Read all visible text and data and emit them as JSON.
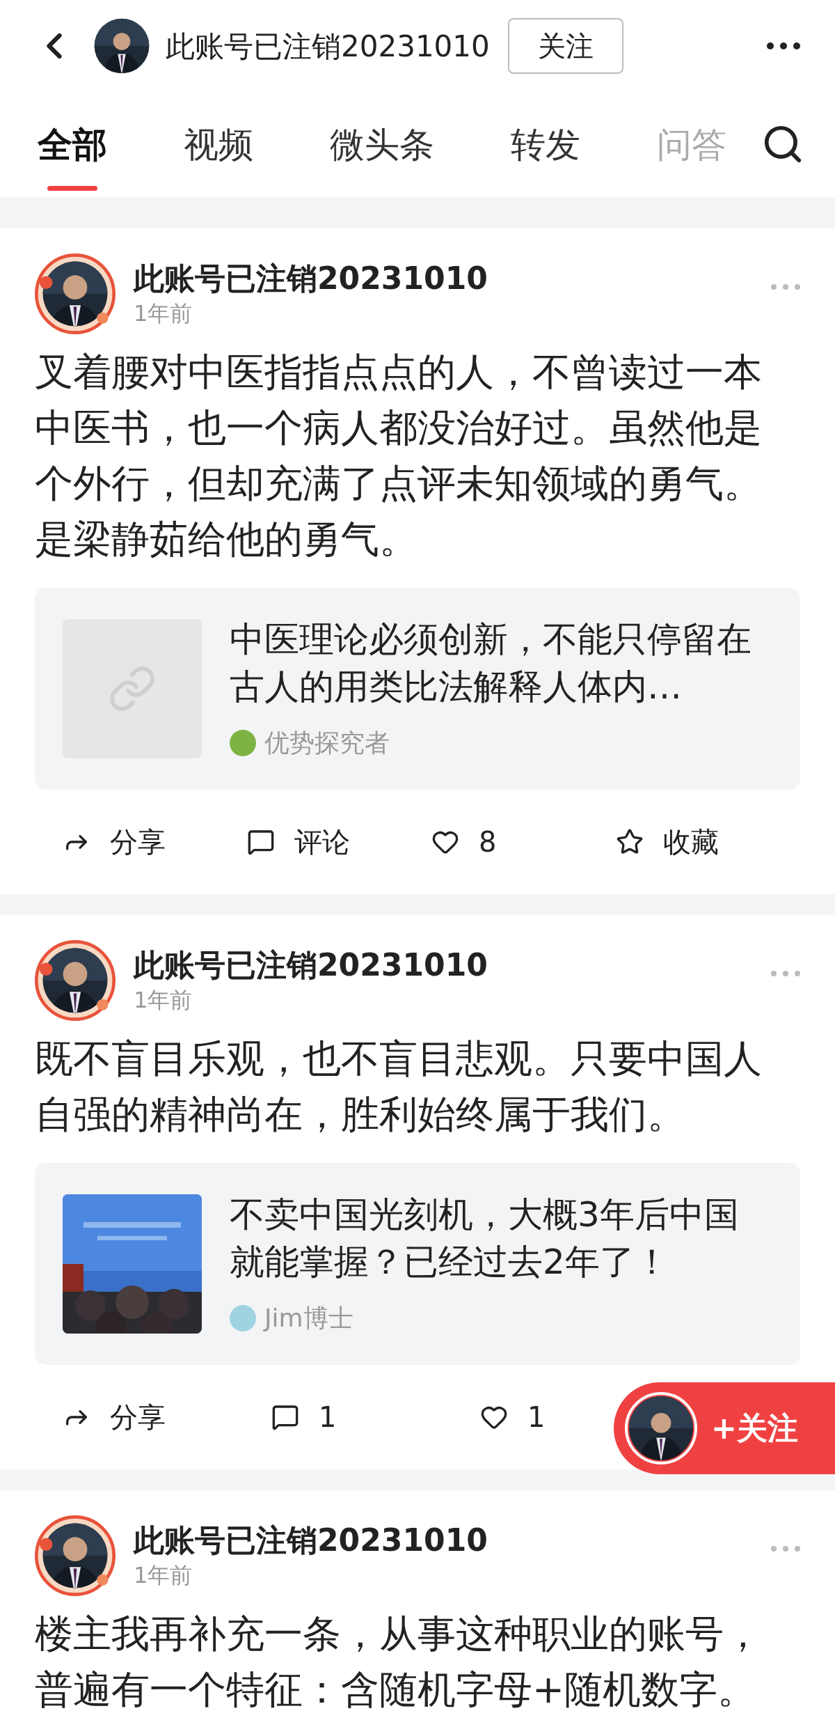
{
  "header": {
    "title": "此账号已注销20231010",
    "follow_button": "关注"
  },
  "tabs": [
    {
      "label": "全部",
      "selected": true
    },
    {
      "label": "视频",
      "selected": false
    },
    {
      "label": "微头条",
      "selected": false
    },
    {
      "label": "转发",
      "selected": false
    },
    {
      "label": "问答",
      "selected": false
    }
  ],
  "posts": [
    {
      "author": "此账号已注销20231010",
      "time": "1年前",
      "body": "叉着腰对中医指指点点的人，不曾读过一本中医书，也一个病人都没治好过。虽然他是个外行，但却充满了点评未知领域的勇气。是梁静茹给他的勇气。",
      "link": {
        "kind": "placeholder",
        "title": "中医理论必须创新，不能只停留在古人的用类比法解释人体内…",
        "source": "优势探究者",
        "color": "#7cb342"
      },
      "actions": [
        {
          "kind": "share",
          "label": "分享"
        },
        {
          "kind": "comment",
          "label": "评论"
        },
        {
          "kind": "like",
          "label": "8"
        },
        {
          "kind": "favorite",
          "label": "收藏"
        }
      ]
    },
    {
      "author": "此账号已注销20231010",
      "time": "1年前",
      "body": "既不盲目乐观，也不盲目悲观。只要中国人自强的精神尚在，胜利始终属于我们。",
      "link": {
        "kind": "picture",
        "title": "不卖中国光刻机，大概3年后中国就能掌握？已经过去2年了！",
        "source": "Jim博士",
        "color": "#9fd3e0"
      },
      "actions": [
        {
          "kind": "share",
          "label": "分享"
        },
        {
          "kind": "comment",
          "label": "1"
        },
        {
          "kind": "like",
          "label": "1"
        }
      ]
    },
    {
      "author": "此账号已注销20231010",
      "time": "1年前",
      "body": "楼主我再补充一条，从事这种职业的账号，普遍有一个特征：含随机字母+随机数字。"
    }
  ],
  "follow_float": {
    "label": "+关注"
  }
}
